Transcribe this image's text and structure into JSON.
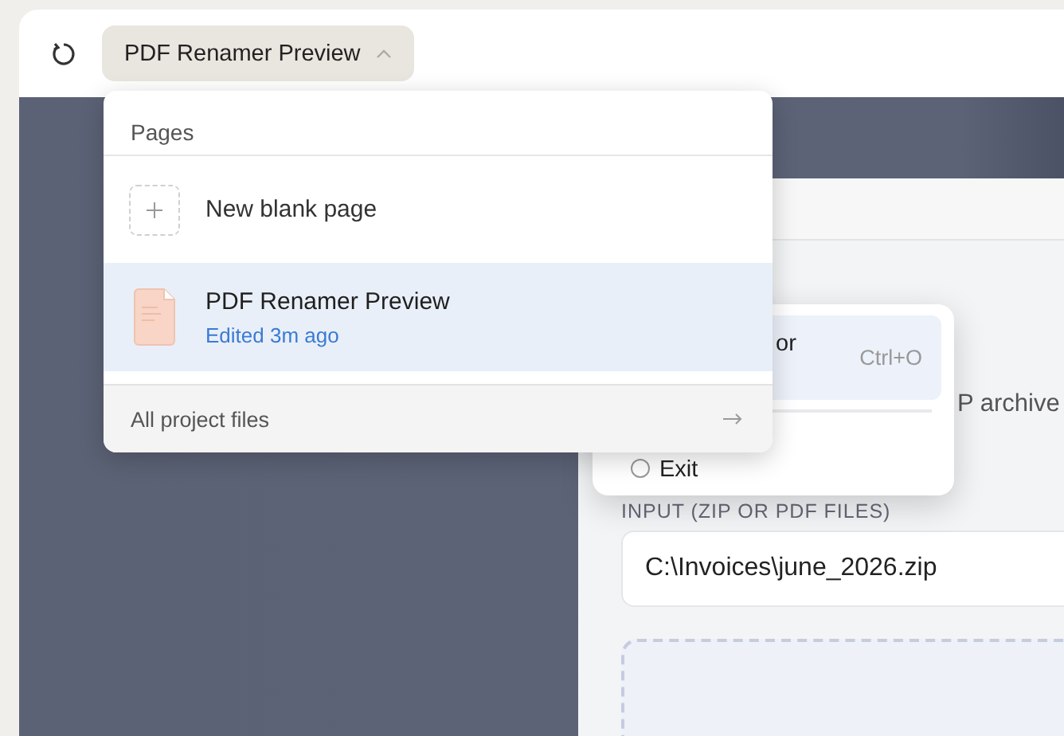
{
  "toolbar": {
    "page_switcher": {
      "label": "PDF Renamer Preview",
      "expanded": true
    }
  },
  "pages_menu": {
    "heading": "Pages",
    "items": [
      {
        "kind": "new",
        "title": "New blank page",
        "selected": false
      },
      {
        "kind": "page",
        "title": "PDF Renamer Preview",
        "subtitle": "Edited 3m ago",
        "selected": true
      }
    ],
    "footer": "All project files"
  },
  "app_window": {
    "description_fragment": "P archive",
    "input_label": "INPUT (ZIP OR PDF FILES)",
    "input_value": "C:\\Invoices\\june_2026.zip"
  },
  "file_menu": {
    "items": [
      {
        "label": "or",
        "shortcut": "Ctrl+O",
        "selected": true
      },
      {
        "label": "Exit",
        "selected": false
      }
    ]
  }
}
